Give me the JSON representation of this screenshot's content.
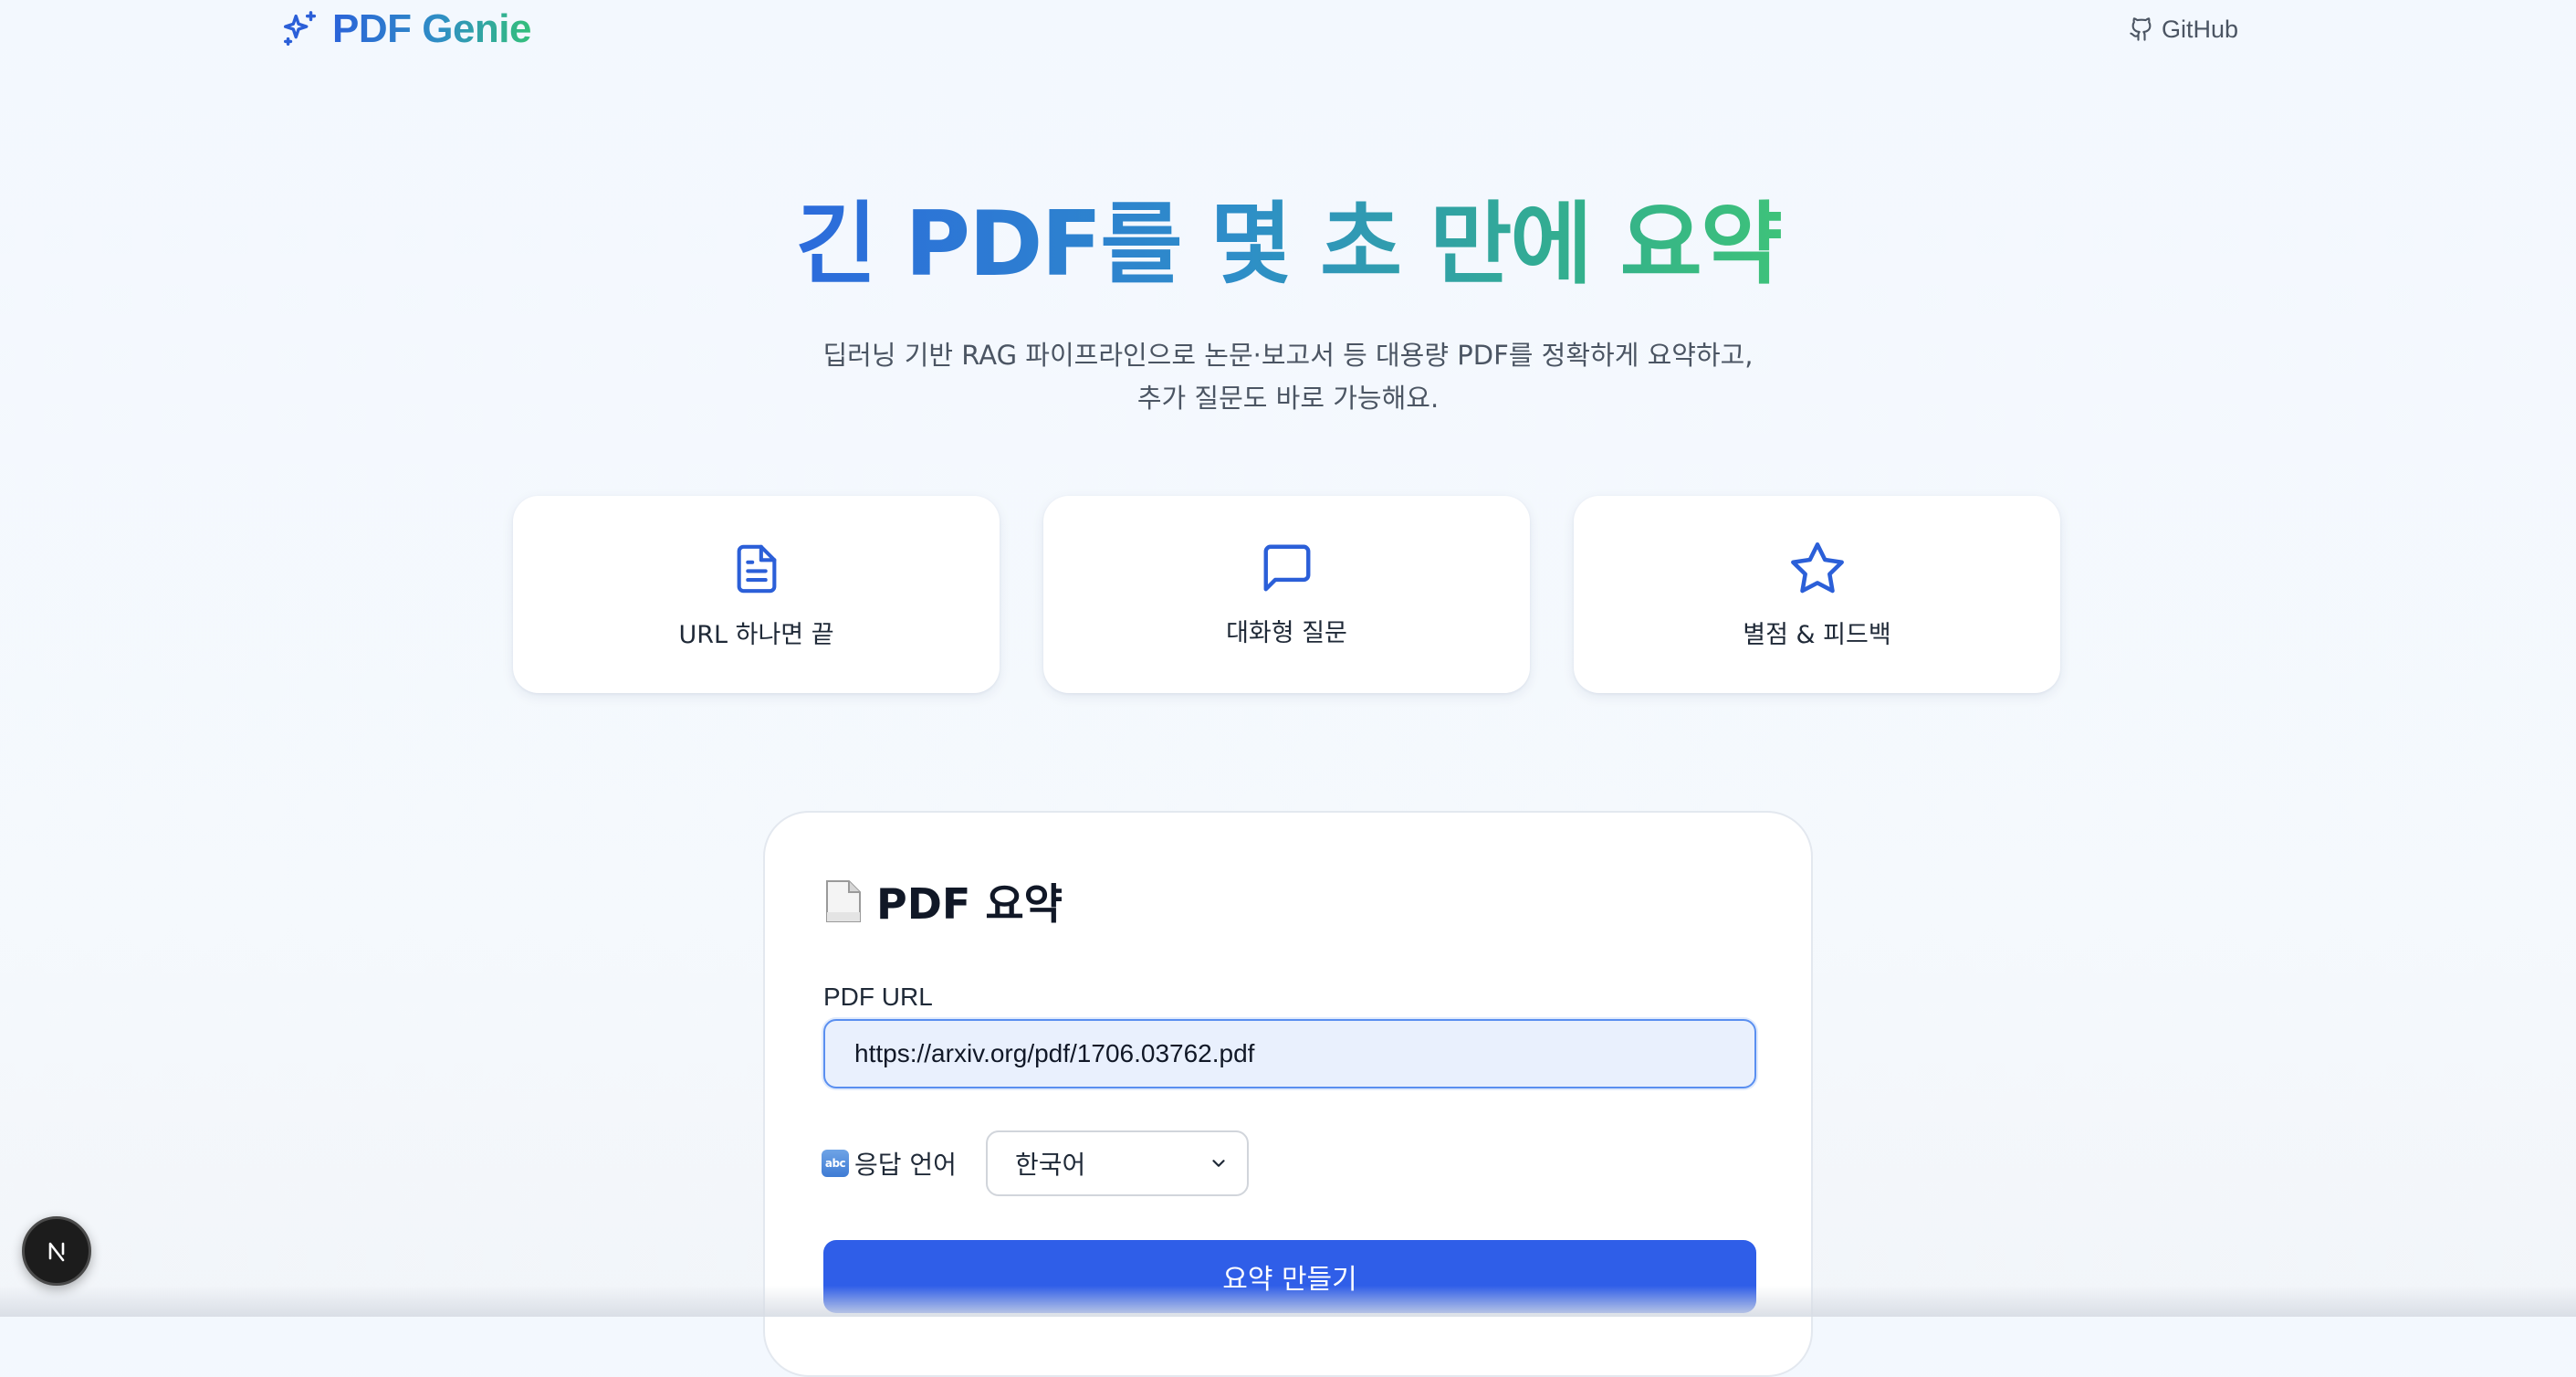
{
  "header": {
    "brand_name": "PDF Genie",
    "brand_icon": "sparkles-icon",
    "github_label": "GitHub",
    "github_icon": "github-icon"
  },
  "hero": {
    "title": "긴 PDF를 몇 초 만에 요약",
    "subtitle_line1": "딥러닝 기반 RAG 파이프라인으로 논문·보고서 등 대용량 PDF를 정확하게 요약하고,",
    "subtitle_line2": "추가 질문도 바로 가능해요."
  },
  "features": [
    {
      "label": "URL 하나면 끝",
      "icon": "document-icon"
    },
    {
      "label": "대화형 질문",
      "icon": "chat-bubble-icon"
    },
    {
      "label": "별점 & 피드백",
      "icon": "star-icon"
    }
  ],
  "summary_form": {
    "title": "PDF 요약",
    "title_icon": "page-emoji-icon",
    "url_label": "PDF URL",
    "url_value": "https://arxiv.org/pdf/1706.03762.pdf",
    "language_icon_text": "abc",
    "language_label": "응답 언어",
    "language_selected": "한국어",
    "submit_label": "요약 만들기"
  },
  "dev_badge": {
    "label": "N"
  },
  "colors": {
    "accent_blue": "#2f5ee8",
    "brand_gradient_start": "#2b63d9",
    "brand_gradient_end": "#34c07a",
    "input_focus_border": "#5a8ff0",
    "input_background": "#e9f0fd",
    "icon_blue": "#2b5fd8"
  }
}
